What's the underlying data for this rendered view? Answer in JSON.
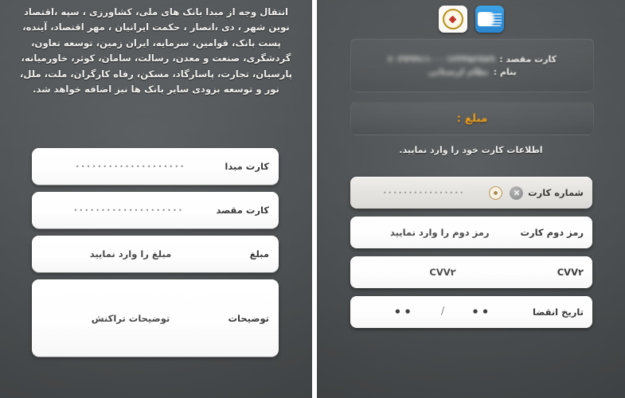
{
  "meta": {
    "accent_orange": "#f0a11e",
    "panel_bg": "#4e5254",
    "field_bg": "#ffffff"
  },
  "left_panel": {
    "intro_paragraph": "انتقال وجه از مبدا بانک های ملی، کشاورزی ، سپه ،اقتصاد نوین شهر ، دی ،انصار ، حکمت ایرانیان ، مهر اقتصاد، آینده، پست بانک، قوامین، سرمایه، ایران زمین، توسعه تعاون، گردشگری، صنعت و معدن، رسالت، سامان، کوثر، خاورمیانه، پارسیان، تجارت، پاسارگاد، مسکن، رفاه کارگران، ملت، ملل، نور و توسعه  بزودی سایر بانک ها نیز اضافه خواهد شد.",
    "fields": [
      {
        "name": "source-card",
        "label": "کارت مبدا",
        "value": "••••••••••••••••••••",
        "value_style": "dots"
      },
      {
        "name": "destination-card",
        "label": "کارت مقصد",
        "value": "••••••••••••••••••••",
        "value_style": "dots"
      },
      {
        "name": "amount",
        "label": "مبلغ",
        "value": "مبلغ را وارد نمایید",
        "value_style": "text"
      },
      {
        "name": "description",
        "label": "توضیحات",
        "value": "توضیحات تراکنش",
        "value_style": "text"
      }
    ]
  },
  "right_panel": {
    "app_icons": [
      {
        "name": "bank-melli-app-icon",
        "label": "بانک ملی"
      },
      {
        "name": "blue-app-icon",
        "label": ""
      }
    ],
    "info": {
      "destination_card_key": "کارت مقصد :",
      "destination_card_value": "۶۰۳۷۹۹۱۱۰۰۰۱۲۳۴۵۶۷۸۹",
      "holder_name_key": "بنام :",
      "holder_name_value": "نظام لرستانی"
    },
    "amount_bar": {
      "label": "مبلغ :"
    },
    "hint": "اطلاعات کارت خود را وارد نمایید.",
    "fields": [
      {
        "name": "card-number",
        "label": "شماره کارت",
        "value": "••••••••••••••••",
        "value_style": "dotted",
        "has_icons": true,
        "icons": [
          "bank-logo-icon",
          "clear-icon"
        ]
      },
      {
        "name": "second-password",
        "label": "رمز دوم کارت",
        "value": "رمز دوم را وارد نمایید",
        "value_style": "text",
        "has_icons": false
      },
      {
        "name": "cvv2",
        "label": "CVV۲",
        "value": "CVV۲",
        "value_style": "text",
        "has_icons": false
      },
      {
        "name": "expiry-date",
        "label": "تاریخ انقضا",
        "expiry": {
          "year": "••",
          "separator": "/",
          "month": "••"
        },
        "value_style": "expiry",
        "has_icons": false
      }
    ]
  }
}
